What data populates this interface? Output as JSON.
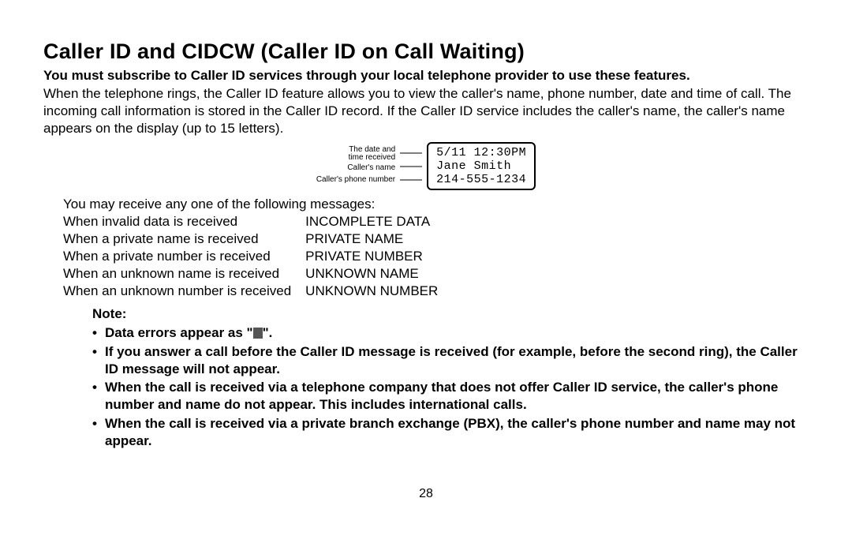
{
  "title": "Caller ID and CIDCW (Caller ID on Call Waiting)",
  "intro_bold": "You must subscribe to Caller ID services through your local telephone provider to use these features.",
  "intro": "When the telephone rings, the Caller ID feature allows you to view the caller's name, phone number, date and time of call. The incoming call information is stored in the Caller ID record. If the Caller ID service includes the caller's name, the caller's name appears on the display (up to 15 letters).",
  "diagram": {
    "label_date_1": "The date and",
    "label_date_2": "time received",
    "label_name": "Caller's name",
    "label_number": "Caller's phone number",
    "lcd_line1": "5/11 12:30PM",
    "lcd_line2": "Jane Smith",
    "lcd_line3": "214-555-1234"
  },
  "messages_intro": "You may receive any one of the following messages:",
  "messages": [
    {
      "cond": "When invalid data is received",
      "msg": "INCOMPLETE DATA"
    },
    {
      "cond": "When a private name is received",
      "msg": "PRIVATE NAME"
    },
    {
      "cond": "When a private number is received",
      "msg": "PRIVATE NUMBER"
    },
    {
      "cond": "When an unknown name is received",
      "msg": "UNKNOWN NAME"
    },
    {
      "cond": "When an unknown number is received",
      "msg": "UNKNOWN NUMBER"
    }
  ],
  "note_heading": "Note:",
  "notes": {
    "n1a": "Data errors appear as \"",
    "n1b": "\".",
    "n2": "If you answer a call before the Caller ID message is received (for example, before the second ring), the Caller ID message will not appear.",
    "n3": "When the call is received via a telephone company that does not offer Caller ID service, the caller's phone number and name do not appear. This includes international calls.",
    "n4": "When the call is received via a private branch exchange (PBX), the caller's phone number and name may not appear."
  },
  "page_number": "28"
}
